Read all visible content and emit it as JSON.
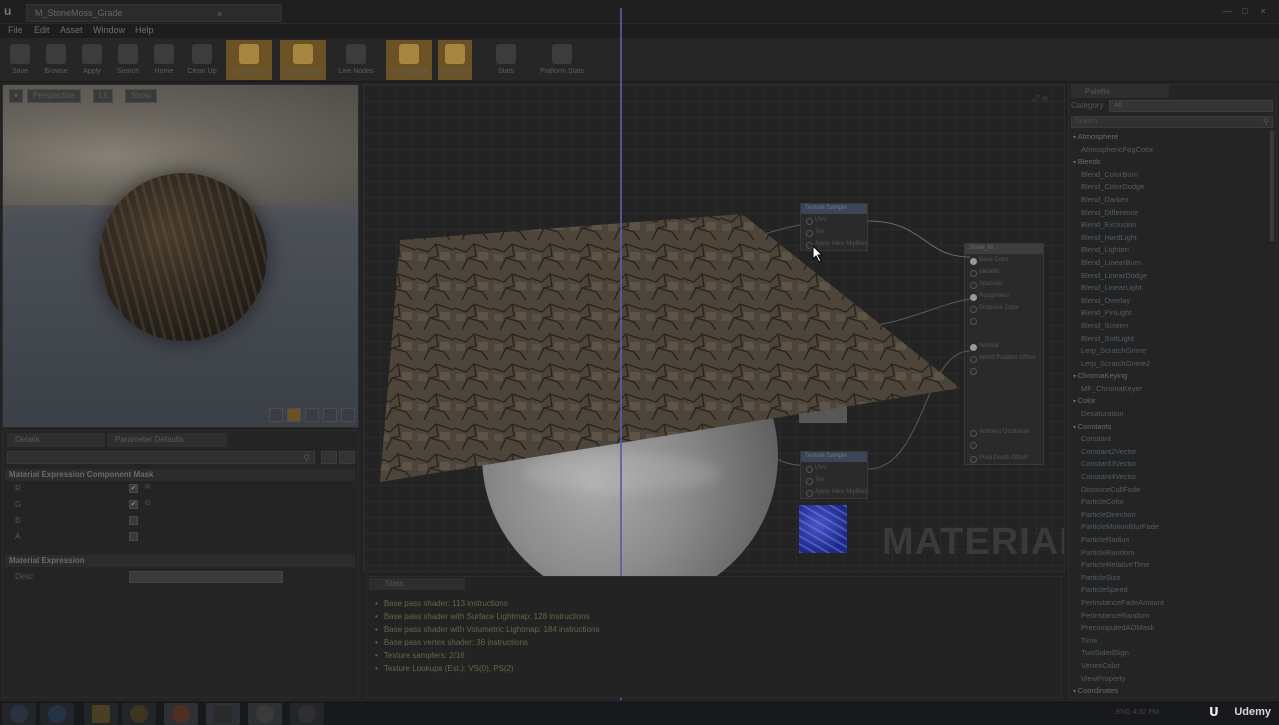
{
  "window": {
    "tab_title": "M_StoneMoss_Grade",
    "close_glyph": "×",
    "controls": [
      "—",
      "□",
      "×"
    ]
  },
  "menu": [
    "File",
    "Edit",
    "Asset",
    "Window",
    "Help"
  ],
  "toolbar": [
    {
      "label": "Save"
    },
    {
      "label": "Browse"
    },
    {
      "label": "Apply"
    },
    {
      "label": "Search"
    },
    {
      "label": "Home"
    },
    {
      "label": "Clean Up"
    },
    {
      "label": "Connectors"
    },
    {
      "label": "Live Preview"
    },
    {
      "label": "Live Nodes"
    },
    {
      "label": "Live Update"
    },
    {
      "label": "Hide Unrelated"
    },
    {
      "label": "Stats"
    },
    {
      "label": "Platform Stats"
    }
  ],
  "viewport": {
    "buttons": [
      "Perspective",
      "Lit",
      "Show"
    ],
    "menu_glyph": "▾"
  },
  "details": {
    "tabs": [
      "Details",
      "Parameter Defaults"
    ],
    "section_mask": "Material Expression Component Mask",
    "mask_rows": [
      {
        "name": "R",
        "checked": true
      },
      {
        "name": "G",
        "checked": true
      },
      {
        "name": "B",
        "checked": false
      },
      {
        "name": "A",
        "checked": false
      }
    ],
    "section_expr": "Material Expression",
    "desc_label": "Desc",
    "check_glyph": "✔"
  },
  "graph": {
    "watermark": "MATERIAL",
    "node_texture_1": {
      "title": "Texture Sample",
      "pins": [
        "UVs",
        "Tex",
        "Apply View MipBias"
      ]
    },
    "node_texture_2": {
      "title": "Texture Sample",
      "pins": [
        "UVs",
        "Tex",
        "Apply View MipBias"
      ]
    },
    "node_result": {
      "title": "Stone_M",
      "pins": [
        "Base Color",
        "Metallic",
        "Specular",
        "Roughness",
        "Emissive Color",
        "Normal",
        "World Position Offset",
        "Ambient Occlusion",
        "Pixel Depth Offset"
      ]
    }
  },
  "stats": {
    "tab": "Stats",
    "lines": [
      "Base pass shader: 113 instructions",
      "Base pass shader with Surface Lightmap: 128 instructions",
      "Base pass shader with Volumetric Lightmap: 184 instructions",
      "Base pass vertex shader: 36 instructions",
      "Texture samplers: 2/16",
      "Texture Lookups (Est.): VS(0), PS(2)"
    ]
  },
  "palette": {
    "tab": "Palette",
    "category_label": "Category",
    "category_value": "All",
    "search_placeholder": "Search",
    "items": [
      {
        "text": "Atmosphere",
        "cat": true
      },
      {
        "text": "AtmosphericFogColor"
      },
      {
        "text": "Blends",
        "cat": true
      },
      {
        "text": "Blend_ColorBurn"
      },
      {
        "text": "Blend_ColorDodge"
      },
      {
        "text": "Blend_Darken"
      },
      {
        "text": "Blend_Difference"
      },
      {
        "text": "Blend_Exclusion"
      },
      {
        "text": "Blend_HardLight"
      },
      {
        "text": "Blend_Lighten"
      },
      {
        "text": "Blend_LinearBurn"
      },
      {
        "text": "Blend_LinearDodge"
      },
      {
        "text": "Blend_LinearLight"
      },
      {
        "text": "Blend_Overlay"
      },
      {
        "text": "Blend_PinLight"
      },
      {
        "text": "Blend_Screen"
      },
      {
        "text": "Blend_SoftLight"
      },
      {
        "text": "Lerp_ScratchGrime"
      },
      {
        "text": "Lerp_ScratchGrime2"
      },
      {
        "text": "ChromaKeying",
        "cat": true
      },
      {
        "text": "MF_ChromaKeyer"
      },
      {
        "text": "Color",
        "cat": true
      },
      {
        "text": "Desaturation"
      },
      {
        "text": "Constants",
        "cat": true
      },
      {
        "text": "Constant"
      },
      {
        "text": "Constant2Vector"
      },
      {
        "text": "Constant3Vector"
      },
      {
        "text": "Constant4Vector"
      },
      {
        "text": "DistanceCullFade"
      },
      {
        "text": "ParticleColor"
      },
      {
        "text": "ParticleDirection"
      },
      {
        "text": "ParticleMotionBlurFade"
      },
      {
        "text": "ParticleRadius"
      },
      {
        "text": "ParticleRandom"
      },
      {
        "text": "ParticleRelativeTime"
      },
      {
        "text": "ParticleSize"
      },
      {
        "text": "ParticleSpeed"
      },
      {
        "text": "PerInstanceFadeAmount"
      },
      {
        "text": "PerInstanceRandom"
      },
      {
        "text": "PrecomputedAOMask"
      },
      {
        "text": "Time"
      },
      {
        "text": "TwoSidedSign"
      },
      {
        "text": "VertexColor"
      },
      {
        "text": "ViewProperty"
      },
      {
        "text": "Coordinates",
        "cat": true
      }
    ]
  },
  "taskbar": {
    "tray_text": "ENG  4:32 PM",
    "brand": "Udemy",
    "brand_glyph": "U"
  }
}
